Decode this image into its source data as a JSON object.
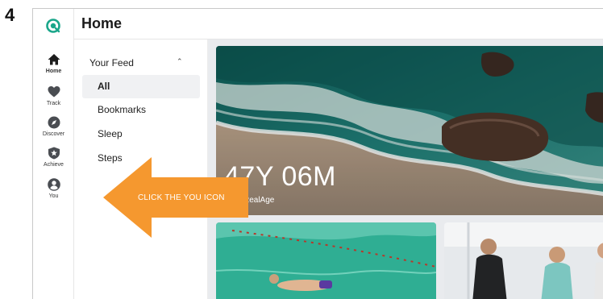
{
  "step": {
    "number": "4"
  },
  "header": {
    "title": "Home"
  },
  "nav": {
    "items": [
      {
        "label": "Home",
        "icon": "home-icon"
      },
      {
        "label": "Track",
        "icon": "heart-icon"
      },
      {
        "label": "Discover",
        "icon": "compass-icon"
      },
      {
        "label": "Achieve",
        "icon": "star-badge-icon"
      },
      {
        "label": "You",
        "icon": "person-icon"
      }
    ]
  },
  "feed": {
    "heading": "Your Feed",
    "items": [
      {
        "label": "All",
        "active": true
      },
      {
        "label": "Bookmarks",
        "active": false
      },
      {
        "label": "Sleep",
        "active": false
      },
      {
        "label": "Steps",
        "active": false
      }
    ]
  },
  "hero": {
    "value": "47Y 06M",
    "subtitle": "Your RealAge"
  },
  "callout": {
    "text": "CLICK THE YOU ICON",
    "color": "#f5982f"
  },
  "colors": {
    "brand": "#1aa68a",
    "accent": "#f5982f"
  }
}
